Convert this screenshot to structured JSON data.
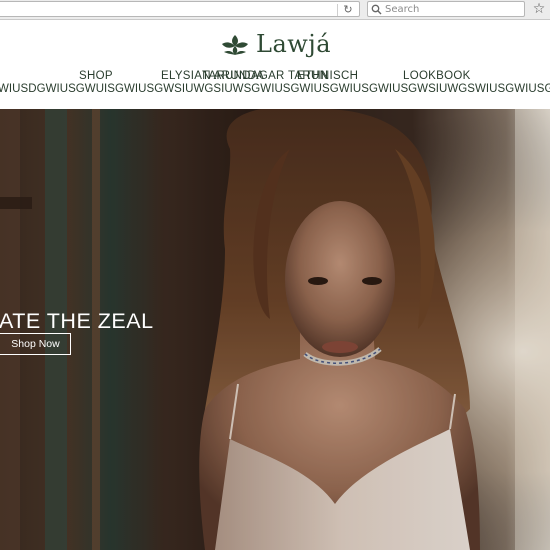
{
  "browser": {
    "search_placeholder": "Search",
    "icons": {
      "reload": "reload-icon",
      "search": "search-icon",
      "bookmark": "star-icon"
    }
  },
  "site": {
    "logo_text": "Lawjá",
    "brand_color": "#2f4a34"
  },
  "nav": {
    "items": [
      {
        "label": "SHOP"
      },
      {
        "label": "ELYSIAN ARUNDA"
      },
      {
        "label": "TARUNDAGAR TARUN"
      },
      {
        "label": "ETHNISCH"
      },
      {
        "label": "LOOKBOOK"
      }
    ],
    "marquee": "WIUSDGWIUSGWUISGWIUSGWSIUWGSIUWSGWIUSGWIUSGWIUSGWIUSGWSIUWGSWIUSGWIUSGWIUSGW"
  },
  "hero": {
    "headline": "ATE THE ZEAL",
    "cta_label": "Shop Now"
  }
}
